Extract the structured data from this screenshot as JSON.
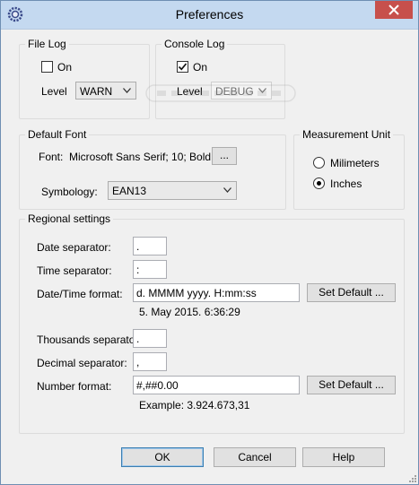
{
  "window": {
    "title": "Preferences"
  },
  "file_log": {
    "title": "File Log",
    "on_label": "On",
    "on_checked": false,
    "level_label": "Level",
    "level_value": "WARN"
  },
  "console_log": {
    "title": "Console Log",
    "on_label": "On",
    "on_checked": true,
    "level_label": "Level",
    "level_value": "DEBUG"
  },
  "default_font": {
    "title": "Default Font",
    "font_label": "Font:",
    "font_value": "Microsoft Sans Serif; 10; Bold",
    "browse_label": "...",
    "symbology_label": "Symbology:",
    "symbology_value": "EAN13"
  },
  "measurement": {
    "title": "Measurement Unit",
    "options": [
      {
        "label": "Milimeters",
        "selected": false
      },
      {
        "label": "Inches",
        "selected": true
      }
    ]
  },
  "regional": {
    "title": "Regional settings",
    "date_sep_label": "Date separator:",
    "date_sep_value": ".",
    "time_sep_label": "Time separator:",
    "time_sep_value": ":",
    "datetime_label": "Date/Time format:",
    "datetime_value": "d. MMMM yyyy. H:mm:ss",
    "datetime_default_btn": "Set Default ...",
    "datetime_example": "5. May 2015. 6:36:29",
    "thousands_label": "Thousands separator:",
    "thousands_value": ".",
    "decimal_label": "Decimal separator:",
    "decimal_value": ",",
    "number_label": "Number format:",
    "number_value": "#,##0.00",
    "number_default_btn": "Set Default ...",
    "number_example": "Example: 3.924.673,31"
  },
  "buttons": {
    "ok": "OK",
    "cancel": "Cancel",
    "help": "Help"
  }
}
